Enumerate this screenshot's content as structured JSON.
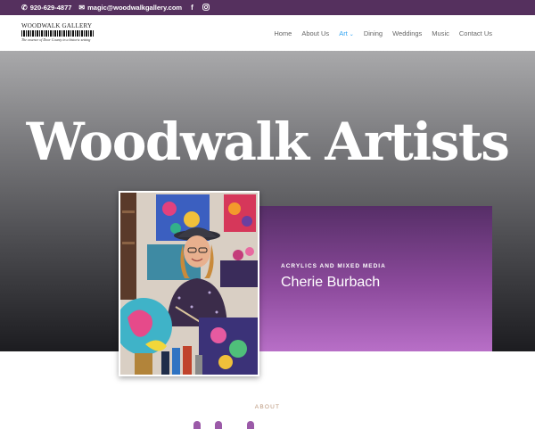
{
  "topbar": {
    "phone": "920-629-4877",
    "email": "magic@woodwalkgallery.com",
    "social": [
      "facebook-icon",
      "instagram-icon"
    ]
  },
  "header": {
    "logo_title": "WOODWALK GALLERY",
    "logo_tagline": "The essence of Door County in a historic setting",
    "nav": [
      {
        "label": "Home"
      },
      {
        "label": "About Us"
      },
      {
        "label": "Art"
      },
      {
        "label": "Dining"
      },
      {
        "label": "Weddings"
      },
      {
        "label": "Music"
      },
      {
        "label": "Contact Us"
      }
    ]
  },
  "hero": {
    "title": "Woodwalk Artists"
  },
  "feature": {
    "subtitle": "ACRYLICS AND MIXED MEDIA",
    "name": "Cherie Burbach"
  },
  "about": {
    "label": "ABOUT"
  },
  "colors": {
    "topbar": "#55305e",
    "accent_nav": "#2ea3f2",
    "card_top": "#562e67",
    "card_bottom": "#b86fc7",
    "about_label": "#b9957a"
  }
}
